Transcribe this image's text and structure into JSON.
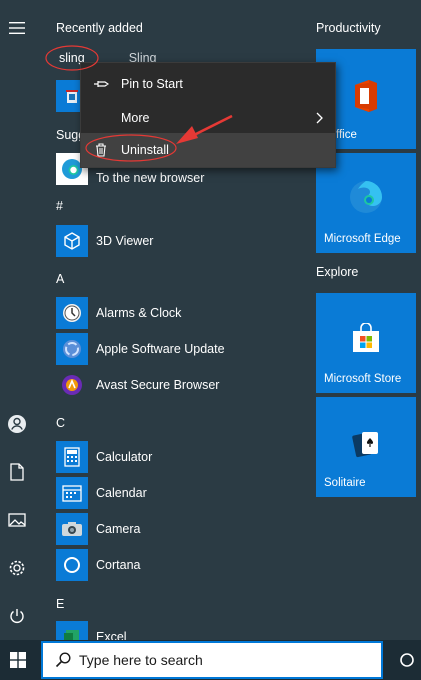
{
  "app_list": {
    "recently_added": "Recently added",
    "recent_item_label": "Sling",
    "recent_item_label_truncated": "sling",
    "suggested_partial": "Sugg",
    "suggested_item": "To the new browser",
    "groups": [
      {
        "letter": "#",
        "apps": [
          "3D Viewer"
        ]
      },
      {
        "letter": "A",
        "apps": [
          "Alarms & Clock",
          "Apple Software Update",
          "Avast Secure Browser"
        ]
      },
      {
        "letter": "C",
        "apps": [
          "Calculator",
          "Calendar",
          "Camera",
          "Cortana"
        ]
      },
      {
        "letter": "E",
        "apps": [
          "Excel"
        ]
      }
    ]
  },
  "context_menu": {
    "pin_label": "Pin to Start",
    "more_label": "More",
    "uninstall_label": "Uninstall"
  },
  "tiles": {
    "productivity_title": "Productivity",
    "office_label": "ffice",
    "edge_label": "Microsoft Edge",
    "explore_title": "Explore",
    "store_label": "Microsoft Store",
    "solitaire_label": "Solitaire"
  },
  "taskbar": {
    "search_placeholder": "Type here to search"
  },
  "colors": {
    "menu_bg": "#2b3b44",
    "tile_blue": "#0a7bd6",
    "annotation_red": "#e53935"
  }
}
